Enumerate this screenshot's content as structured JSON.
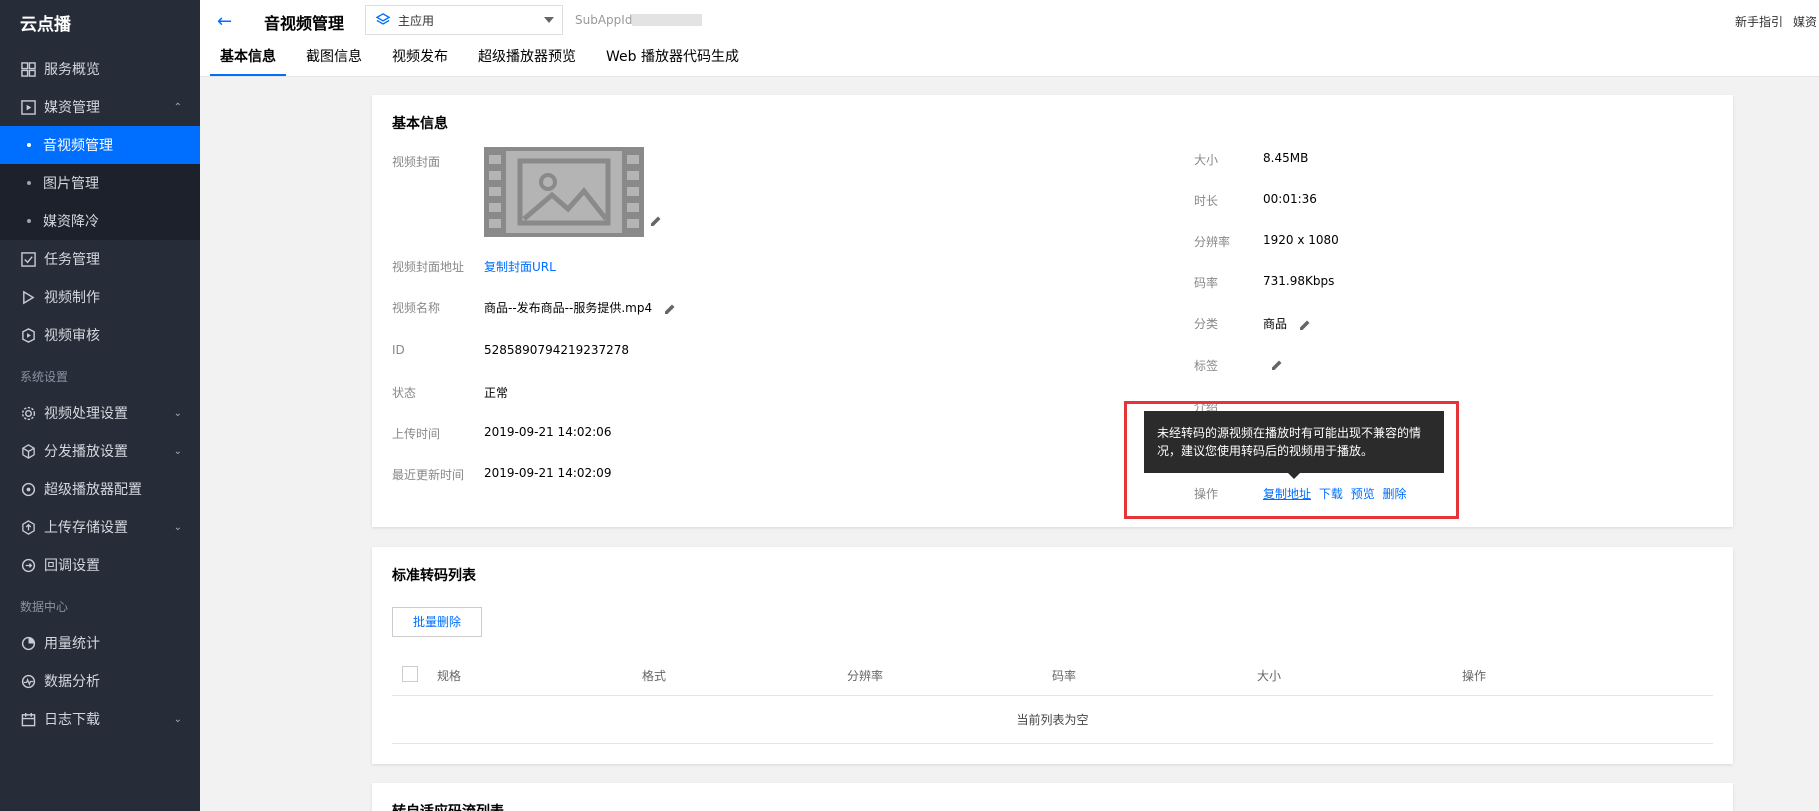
{
  "sidebar": {
    "brand": "云点播",
    "items_top": [
      {
        "label": "服务概览",
        "icon": "grid-icon"
      }
    ],
    "media_group": {
      "label": "媒资管理",
      "icon": "play-square-icon",
      "expanded": true,
      "children": [
        {
          "label": "音视频管理",
          "active": true
        },
        {
          "label": "图片管理",
          "active": false
        },
        {
          "label": "媒资降冷",
          "active": false
        }
      ]
    },
    "items_mid": [
      {
        "label": "任务管理",
        "icon": "check-square-icon"
      },
      {
        "label": "视频制作",
        "icon": "play-triangle-icon"
      },
      {
        "label": "视频审核",
        "icon": "shield-play-icon"
      }
    ],
    "section_settings": "系统设置",
    "settings_items": [
      {
        "label": "视频处理设置",
        "icon": "gear-icon",
        "chevron": true
      },
      {
        "label": "分发播放设置",
        "icon": "cube-icon",
        "chevron": true
      },
      {
        "label": "超级播放器配置",
        "icon": "player-icon",
        "chevron": false
      },
      {
        "label": "上传存储设置",
        "icon": "upload-icon",
        "chevron": true
      },
      {
        "label": "回调设置",
        "icon": "refresh-icon",
        "chevron": false
      }
    ],
    "section_data": "数据中心",
    "data_items": [
      {
        "label": "用量统计",
        "icon": "pie-icon",
        "chevron": false
      },
      {
        "label": "数据分析",
        "icon": "pulse-icon",
        "chevron": false
      },
      {
        "label": "日志下载",
        "icon": "calendar-icon",
        "chevron": true
      }
    ]
  },
  "header": {
    "title": "音视频管理",
    "app_select": "主应用",
    "subappid_label": "SubAppId:",
    "guide": "新手指引",
    "media_cut": "媒资",
    "tabs": [
      {
        "label": "基本信息",
        "active": true
      },
      {
        "label": "截图信息",
        "active": false
      },
      {
        "label": "视频发布",
        "active": false
      },
      {
        "label": "超级播放器预览",
        "active": false
      },
      {
        "label": "Web 播放器代码生成",
        "active": false
      }
    ]
  },
  "basic": {
    "title": "基本信息",
    "cover_label": "视频封面",
    "cover_url_label": "视频封面地址",
    "cover_url_link": "复制封面URL",
    "name_label": "视频名称",
    "name_value": "商品--发布商品--服务提供.mp4",
    "id_label": "ID",
    "id_value": "5285890794219237278",
    "status_label": "状态",
    "status_value": "正常",
    "upload_label": "上传时间",
    "upload_value": "2019-09-21 14:02:06",
    "update_label": "最近更新时间",
    "update_value": "2019-09-21 14:02:09",
    "size_label": "大小",
    "size_value": "8.45MB",
    "duration_label": "时长",
    "duration_value": "00:01:36",
    "resolution_label": "分辨率",
    "resolution_value": "1920 x 1080",
    "bitrate_label": "码率",
    "bitrate_value": "731.98Kbps",
    "category_label": "分类",
    "category_value": "商品",
    "tags_label": "标签",
    "intro_label": "介绍",
    "ops_label": "操作",
    "ops": [
      "复制地址",
      "下载",
      "预览",
      "删除"
    ],
    "tooltip": "未经转码的源视频在播放时有可能出现不兼容的情况，建议您使用转码后的视频用于播放。"
  },
  "transcode": {
    "title": "标准转码列表",
    "batch_delete": "批量删除",
    "columns": [
      "规格",
      "格式",
      "分辨率",
      "码率",
      "大小",
      "操作"
    ],
    "empty": "当前列表为空"
  },
  "adaptive": {
    "title": "转自适应码流列表"
  }
}
